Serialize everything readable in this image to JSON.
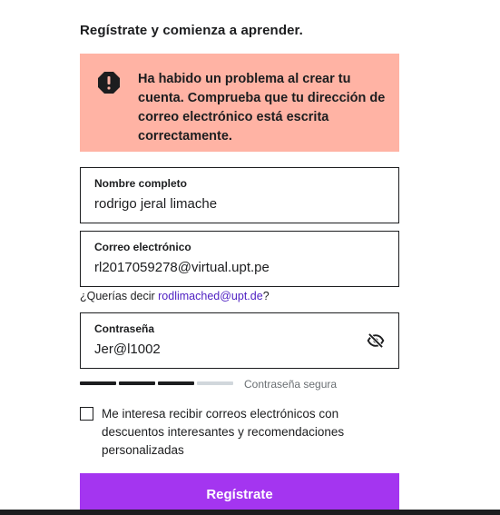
{
  "page_title": "Regístrate y comienza a aprender.",
  "alert": {
    "icon": "exclamation-circle-icon",
    "message": "Ha habido un problema al crear tu cuenta. Comprueba que tu dirección de correo electrónico está escrita correctamente.",
    "background": "#ffb3a4"
  },
  "fields": {
    "full_name": {
      "label": "Nombre completo",
      "value": "rodrigo jeral limache"
    },
    "email": {
      "label": "Correo electrónico",
      "value": "rl2017059278@virtual.upt.pe"
    },
    "password": {
      "label": "Contraseña",
      "value": "Jer@l1002",
      "toggle_icon": "eye-slash-icon"
    }
  },
  "suggestion": {
    "prefix": "¿Querías decir ",
    "link": "rodlimached@upt.de",
    "suffix": "?"
  },
  "password_strength": {
    "label": "Contraseña segura",
    "filled_segments": 3,
    "total_segments": 4,
    "filled_color": "#1c1d1f",
    "empty_color": "#d1d7dc"
  },
  "marketing_opt_in": {
    "checked": false,
    "label": "Me interesa recibir correos electrónicos con descuentos interesantes y recomendaciones personalizadas"
  },
  "submit": {
    "label": "Regístrate",
    "color": "#a435f0"
  }
}
